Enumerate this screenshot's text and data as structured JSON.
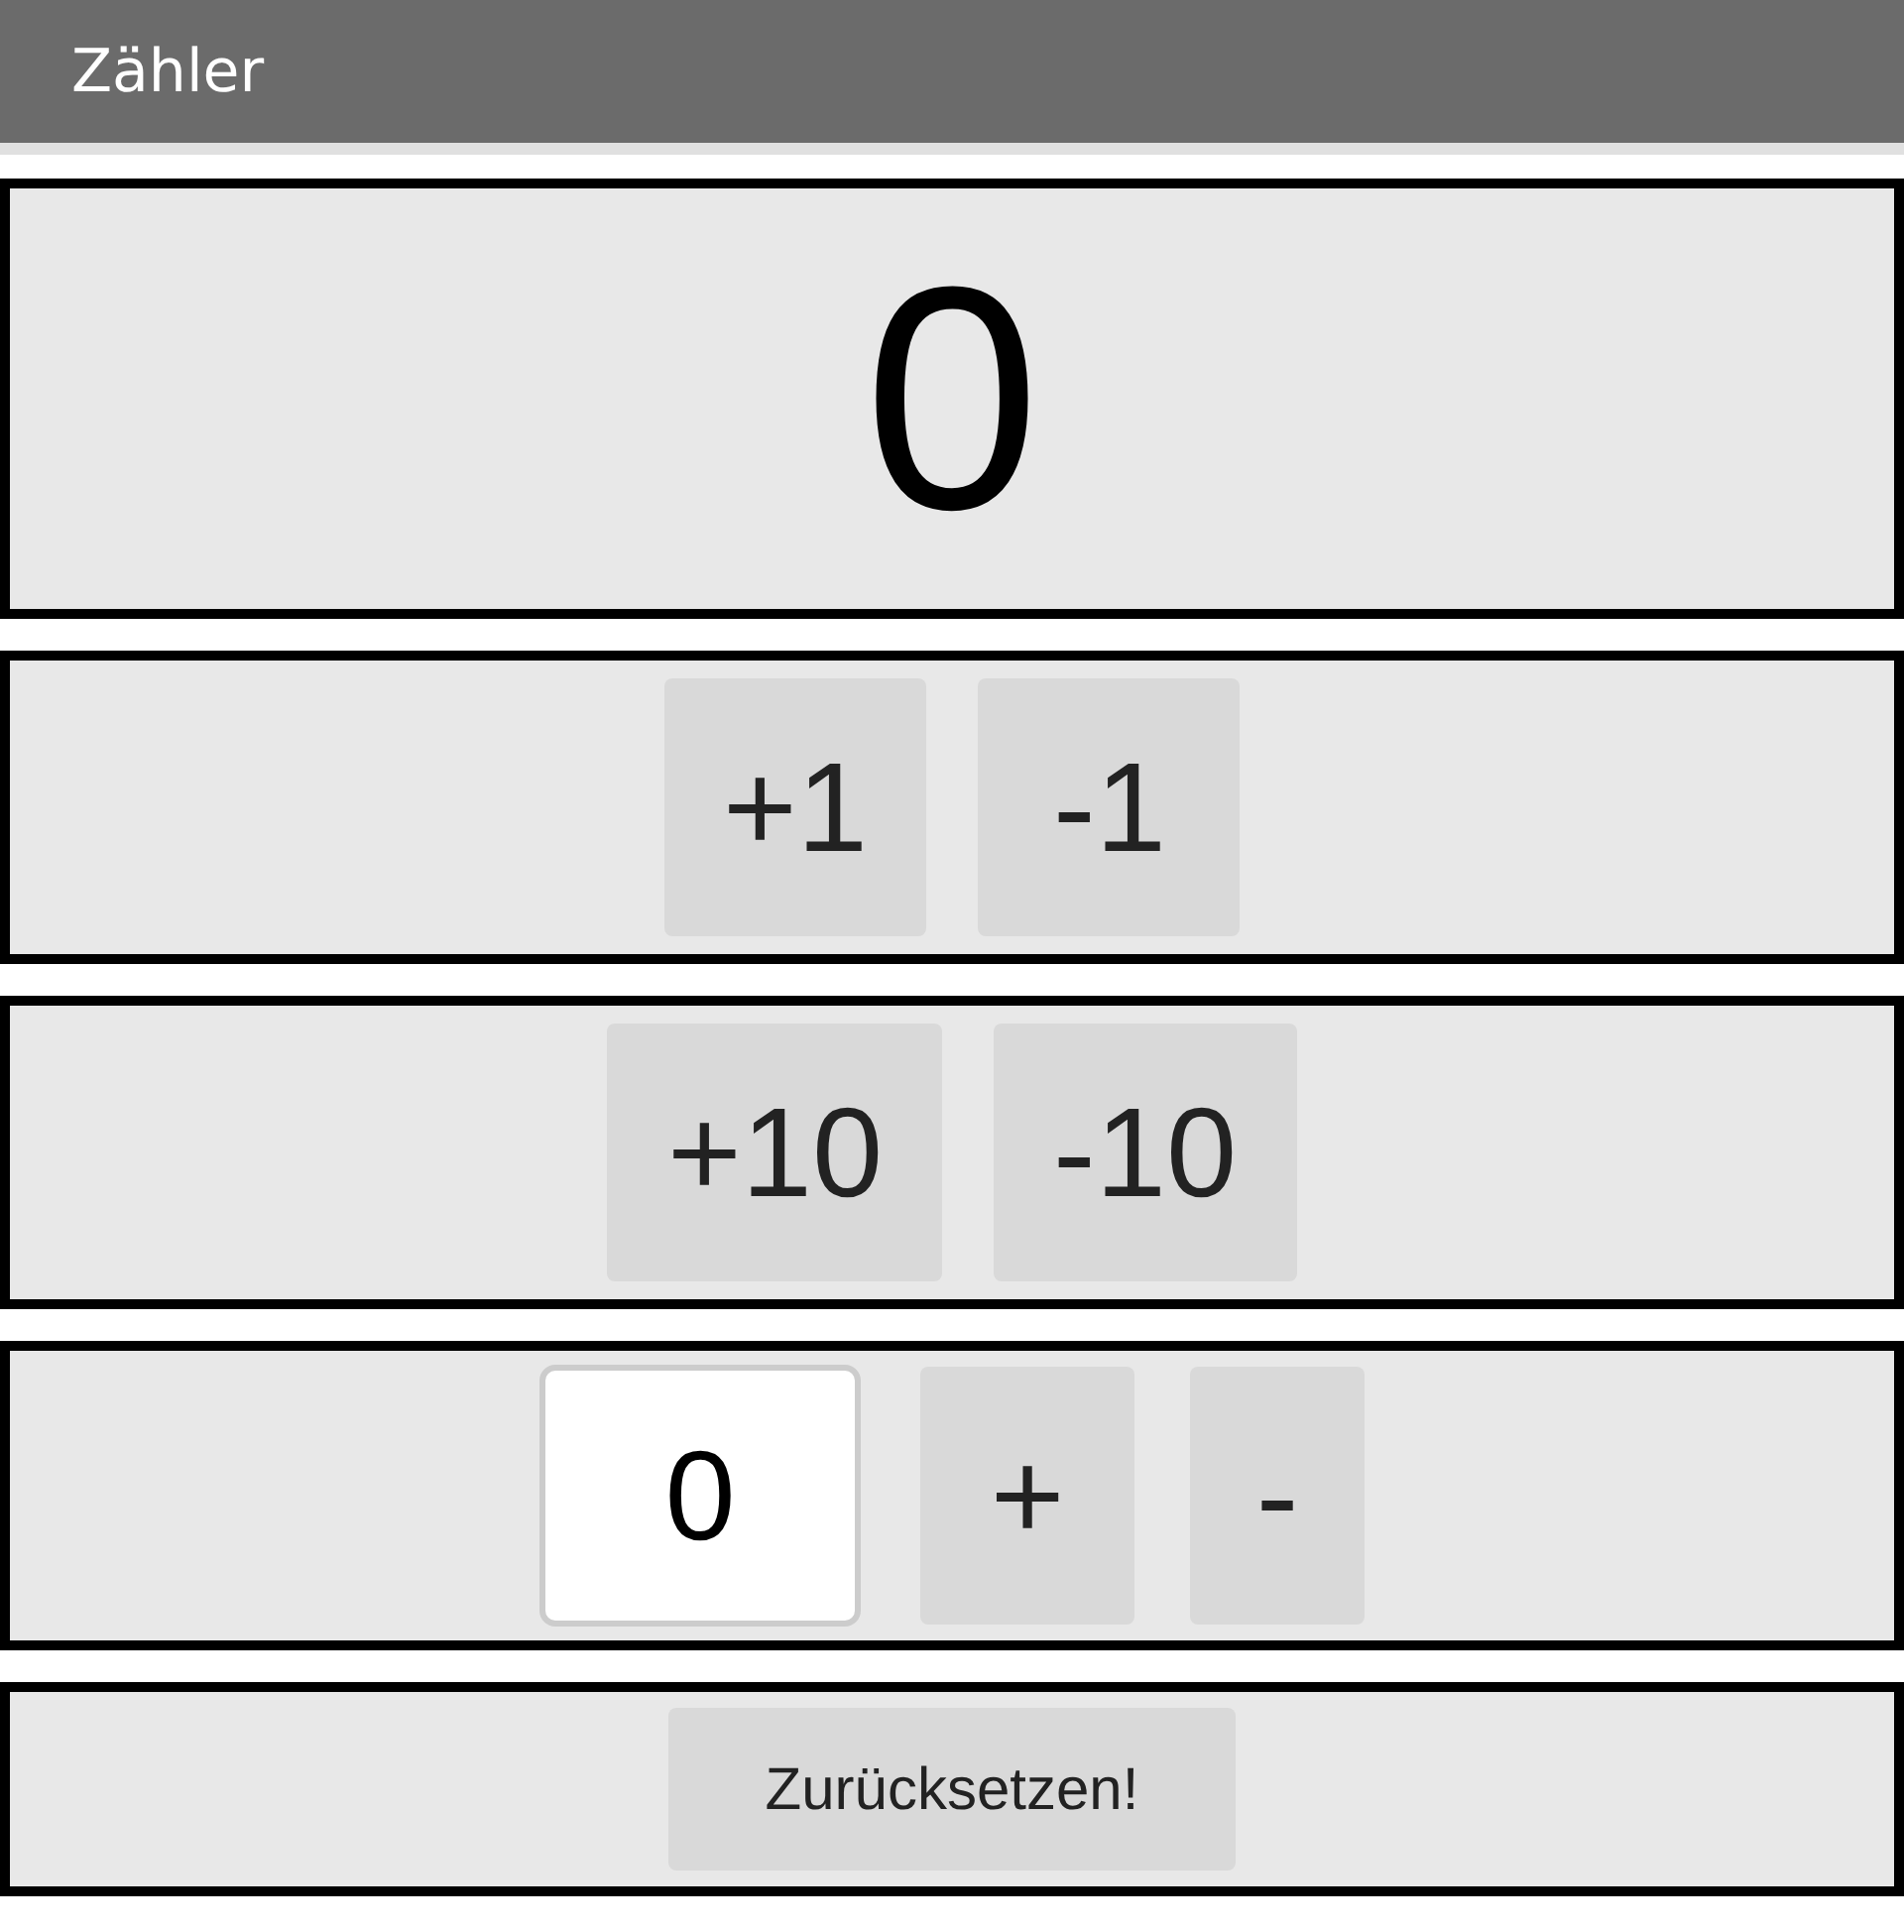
{
  "app_bar": {
    "title": "Zähler"
  },
  "counter": {
    "value": "0"
  },
  "step_rows": [
    {
      "buttons": [
        "+1",
        "-1"
      ]
    },
    {
      "buttons": [
        "+10",
        "-10"
      ]
    }
  ],
  "custom_step": {
    "value": "0",
    "buttons": [
      "+",
      "-"
    ]
  },
  "reset_button": "Zurücksetzen!"
}
